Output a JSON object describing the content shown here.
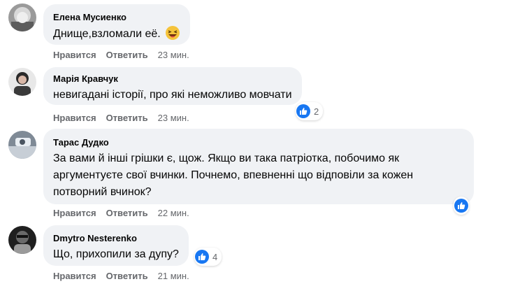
{
  "comments": [
    {
      "author": "Елена Мусиенко",
      "text": "Днище,взломали её.",
      "inline_emoji": "laughing-emoji",
      "like_label": "Нравится",
      "reply_label": "Ответить",
      "time": "23 мин."
    },
    {
      "author": "Марія Кравчук",
      "text": "невигадані історії, про які неможливо мовчати",
      "like_label": "Нравится",
      "reply_label": "Ответить",
      "time": "23 мин.",
      "reactions": {
        "icon": "like-icon",
        "count": "2"
      }
    },
    {
      "author": "Тарас Дудко",
      "text": "За вами й інші грішки є, щож. Якщо ви така патріотка, побочимо як аргументуєте свої вчинки. Почнемо, впевненні що відповіли за кожен потворний вчинок?",
      "like_label": "Нравится",
      "reply_label": "Ответить",
      "time": "22 мин.",
      "reactions": {
        "icon": "like-icon",
        "count": ""
      }
    },
    {
      "author": "Dmytro Nesterenko",
      "text": "Що, прихопили за дупу?",
      "like_label": "Нравится",
      "reply_label": "Ответить",
      "time": "21 мин.",
      "reactions": {
        "icon": "like-icon",
        "count": "4"
      }
    }
  ],
  "colors": {
    "bubble": "#f0f2f5",
    "secondary_text": "#65676b",
    "like_blue": "#1877f2"
  }
}
